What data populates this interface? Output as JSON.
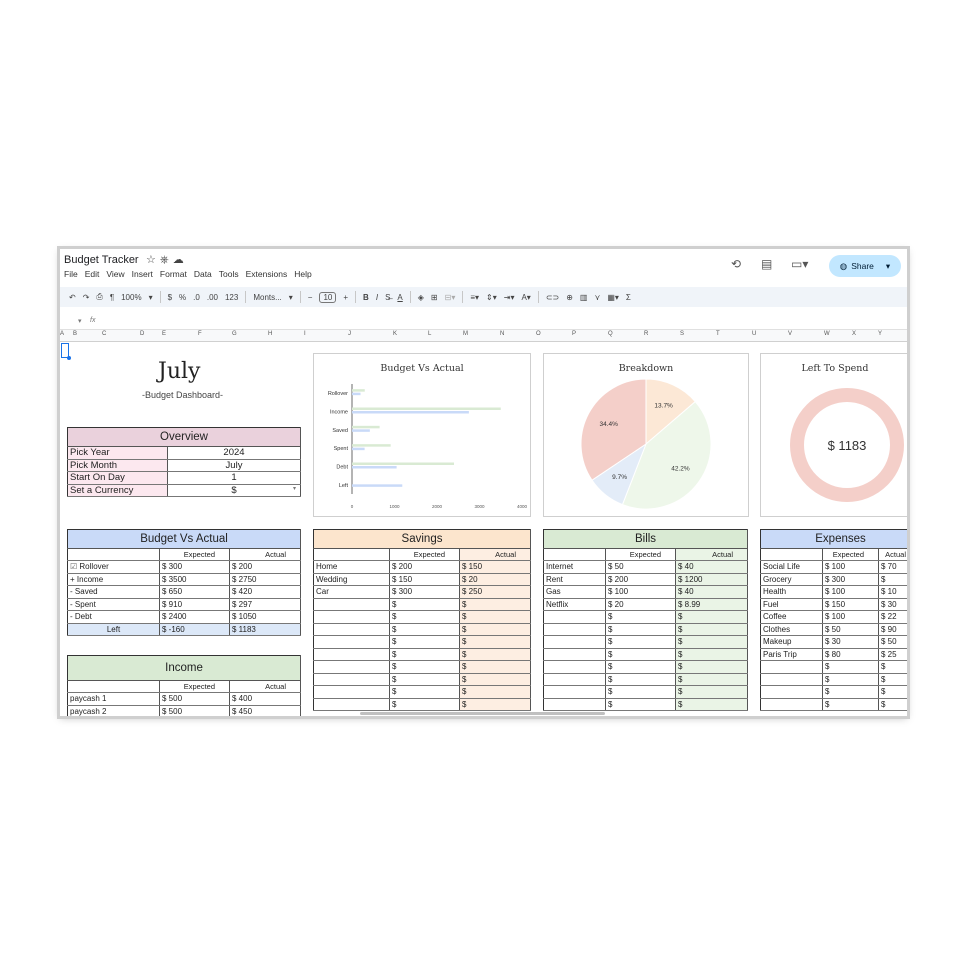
{
  "app": {
    "title": "Budget Tracker",
    "menu": [
      "File",
      "Edit",
      "View",
      "Insert",
      "Format",
      "Data",
      "Tools",
      "Extensions",
      "Help"
    ],
    "share_label": "Share"
  },
  "toolbar": {
    "zoom": "100%",
    "currency": "$",
    "percent": "%",
    "dec_decrease": ".0",
    "dec_increase": ".00",
    "number_format": "123",
    "font": "Monts...",
    "font_size": "10",
    "bold": "B",
    "italic": "I",
    "sum": "Σ"
  },
  "formula_bar": {
    "fx": "fx"
  },
  "columns": [
    "A",
    "B",
    "C",
    "D",
    "E",
    "F",
    "G",
    "H",
    "I",
    "J",
    "K",
    "L",
    "M",
    "N",
    "O",
    "P",
    "Q",
    "R",
    "S",
    "T",
    "U",
    "V",
    "W",
    "X",
    "Y"
  ],
  "header": {
    "month": "July",
    "subtitle": "-Budget Dashboard-"
  },
  "overview": {
    "title": "Overview",
    "rows": [
      {
        "label": "Pick Year",
        "value": "2024"
      },
      {
        "label": "Pick Month",
        "value": "July"
      },
      {
        "label": "Start On Day",
        "value": "1"
      },
      {
        "label": "Set a Currency",
        "value": "$"
      }
    ]
  },
  "budget_vs_actual": {
    "title": "Budget Vs Actual",
    "col_expected": "Expected",
    "col_actual": "Actual",
    "rows": [
      {
        "prefix": "☑",
        "label": "Rollover",
        "expected": "$ 300",
        "actual": "$ 200"
      },
      {
        "prefix": "+",
        "label": "Income",
        "expected": "$ 3500",
        "actual": "$ 2750"
      },
      {
        "prefix": "-",
        "label": "Saved",
        "expected": "$ 650",
        "actual": "$ 420"
      },
      {
        "prefix": "-",
        "label": "Spent",
        "expected": "$ 910",
        "actual": "$ 297"
      },
      {
        "prefix": "-",
        "label": "Debt",
        "expected": "$ 2400",
        "actual": "$ 1050"
      }
    ],
    "left": {
      "label": "Left",
      "expected": "$ -160",
      "actual": "$ 1183"
    }
  },
  "income": {
    "title": "Income",
    "col_expected": "Expected",
    "col_actual": "Actual",
    "rows": [
      {
        "label": "paycash 1",
        "expected": "$ 500",
        "actual": "$ 400"
      },
      {
        "label": "paycash 2",
        "expected": "$ 500",
        "actual": "$ 450"
      }
    ]
  },
  "savings": {
    "title": "Savings",
    "col_expected": "Expected",
    "col_actual": "Actual",
    "rows": [
      {
        "label": "Home",
        "expected": "$ 200",
        "actual": "$ 150"
      },
      {
        "label": "Wedding",
        "expected": "$ 150",
        "actual": "$ 20"
      },
      {
        "label": "Car",
        "expected": "$ 300",
        "actual": "$ 250"
      },
      {
        "label": "",
        "expected": "$",
        "actual": "$"
      },
      {
        "label": "",
        "expected": "$",
        "actual": "$"
      },
      {
        "label": "",
        "expected": "$",
        "actual": "$"
      },
      {
        "label": "",
        "expected": "$",
        "actual": "$"
      },
      {
        "label": "",
        "expected": "$",
        "actual": "$"
      },
      {
        "label": "",
        "expected": "$",
        "actual": "$"
      },
      {
        "label": "",
        "expected": "$",
        "actual": "$"
      },
      {
        "label": "",
        "expected": "$",
        "actual": "$"
      },
      {
        "label": "",
        "expected": "$",
        "actual": "$"
      }
    ]
  },
  "bills": {
    "title": "Bills",
    "col_expected": "Expected",
    "col_actual": "Actual",
    "rows": [
      {
        "label": "Internet",
        "expected": "$ 50",
        "actual": "$ 40"
      },
      {
        "label": "Rent",
        "expected": "$ 200",
        "actual": "$ 1200"
      },
      {
        "label": "Gas",
        "expected": "$ 100",
        "actual": "$ 40"
      },
      {
        "label": "Netflix",
        "expected": "$ 20",
        "actual": "$ 8.99"
      },
      {
        "label": "",
        "expected": "$",
        "actual": "$"
      },
      {
        "label": "",
        "expected": "$",
        "actual": "$"
      },
      {
        "label": "",
        "expected": "$",
        "actual": "$"
      },
      {
        "label": "",
        "expected": "$",
        "actual": "$"
      },
      {
        "label": "",
        "expected": "$",
        "actual": "$"
      },
      {
        "label": "",
        "expected": "$",
        "actual": "$"
      },
      {
        "label": "",
        "expected": "$",
        "actual": "$"
      },
      {
        "label": "",
        "expected": "$",
        "actual": "$"
      }
    ]
  },
  "expenses": {
    "title": "Expenses",
    "col_expected": "Expected",
    "col_actual": "Actual",
    "rows": [
      {
        "label": "Social Life",
        "expected": "$ 100",
        "actual": "$ 70"
      },
      {
        "label": "Grocery",
        "expected": "$ 300",
        "actual": "$"
      },
      {
        "label": "Health",
        "expected": "$ 100",
        "actual": "$ 10"
      },
      {
        "label": "Fuel",
        "expected": "$ 150",
        "actual": "$ 30"
      },
      {
        "label": "Coffee",
        "expected": "$ 100",
        "actual": "$ 22"
      },
      {
        "label": "Clothes",
        "expected": "$ 50",
        "actual": "$ 90"
      },
      {
        "label": "Makeup",
        "expected": "$ 30",
        "actual": "$ 50"
      },
      {
        "label": "Paris Trip",
        "expected": "$ 80",
        "actual": "$ 25"
      },
      {
        "label": "",
        "expected": "$",
        "actual": "$"
      },
      {
        "label": "",
        "expected": "$",
        "actual": "$"
      },
      {
        "label": "",
        "expected": "$",
        "actual": "$"
      },
      {
        "label": "",
        "expected": "$",
        "actual": "$"
      }
    ]
  },
  "chart_data": [
    {
      "type": "bar",
      "orientation": "horizontal",
      "title": "Budget Vs Actual",
      "categories": [
        "Rollover",
        "Income",
        "Saved",
        "Spent",
        "Debt",
        "Left"
      ],
      "series": [
        {
          "values": [
            300,
            3500,
            650,
            910,
            2400,
            -160
          ],
          "color": "#d9ead3"
        },
        {
          "values": [
            200,
            2750,
            420,
            297,
            1050,
            1183
          ],
          "color": "#c9daf8"
        }
      ],
      "xticks": [
        "0",
        "1000",
        "2000",
        "3000",
        "4000"
      ],
      "xlim": [
        0,
        4000
      ]
    },
    {
      "type": "pie",
      "title": "Breakdown",
      "slices": [
        {
          "value": 13.7,
          "label": "13.7%",
          "color": "#fce8d6"
        },
        {
          "value": 42.2,
          "label": "42.2%",
          "color": "#eef7ea"
        },
        {
          "value": 9.7,
          "label": "9.7%",
          "color": "#e3ecf8"
        },
        {
          "value": 34.4,
          "label": "34.4%",
          "color": "#f4cfc9"
        }
      ]
    },
    {
      "type": "pie",
      "donut": true,
      "title": "Left To Spend",
      "center_label": "$ 1183",
      "color": "#f4cfc9"
    }
  ]
}
